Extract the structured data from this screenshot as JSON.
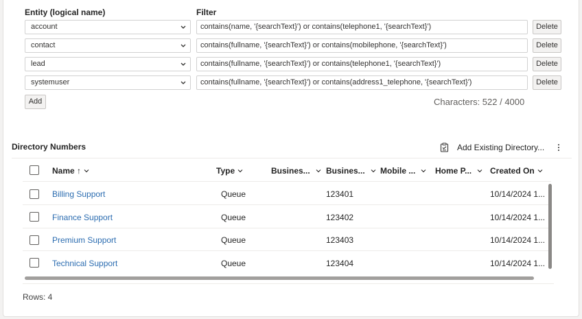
{
  "config": {
    "entity_header": "Entity (logical name)",
    "filter_header": "Filter",
    "rows": [
      {
        "entity": "account",
        "filter": "contains(name, '{searchText}') or contains(telephone1, '{searchText}')",
        "delete_label": "Delete"
      },
      {
        "entity": "contact",
        "filter": "contains(fullname, '{searchText}') or contains(mobilephone, '{searchText}')",
        "delete_label": "Delete"
      },
      {
        "entity": "lead",
        "filter": "contains(fullname, '{searchText}') or contains(telephone1, '{searchText}')",
        "delete_label": "Delete"
      },
      {
        "entity": "systemuser",
        "filter": "contains(fullname, '{searchText}') or contains(address1_telephone, '{searchText}')",
        "delete_label": "Delete"
      }
    ],
    "add_label": "Add",
    "characters_text": "Characters: 522 / 4000"
  },
  "grid": {
    "title": "Directory Numbers",
    "add_existing_label": "Add Existing Directory...",
    "columns": [
      "Name ↑",
      "Type",
      "Busines...",
      "Busines...",
      "Mobile ...",
      "Home P...",
      "Created On"
    ],
    "rows": [
      {
        "name": "Billing Support",
        "type": "Queue",
        "business1": "",
        "business2": "123401",
        "mobile": "",
        "home": "",
        "created": "10/14/2024 1..."
      },
      {
        "name": "Finance Support",
        "type": "Queue",
        "business1": "",
        "business2": "123402",
        "mobile": "",
        "home": "",
        "created": "10/14/2024 1..."
      },
      {
        "name": "Premium Support",
        "type": "Queue",
        "business1": "",
        "business2": "123403",
        "mobile": "",
        "home": "",
        "created": "10/14/2024 1..."
      },
      {
        "name": "Technical Support",
        "type": "Queue",
        "business1": "",
        "business2": "123404",
        "mobile": "",
        "home": "",
        "created": "10/14/2024 1..."
      }
    ],
    "footer_rows": "Rows: 4"
  },
  "icons": {
    "select_chevron": "chevron-down-icon",
    "sort_chevron": "chevron-down-icon",
    "add_existing": "clipboard-icon",
    "more": "more-vertical-icon"
  },
  "colors": {
    "link": "#2b6cb0",
    "border": "#d1d1d1",
    "button_bg": "#f3f2f1"
  }
}
